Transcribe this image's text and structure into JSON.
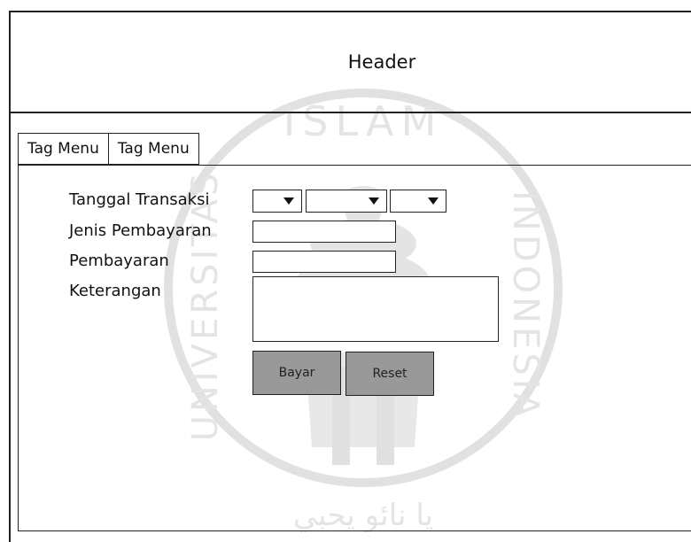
{
  "header": {
    "title": "Header"
  },
  "tabs": [
    {
      "label": "Tag Menu"
    },
    {
      "label": "Tag Menu"
    }
  ],
  "form": {
    "fields": [
      {
        "label": "Tanggal Transaksi"
      },
      {
        "label": "Jenis Pembayaran"
      },
      {
        "label": "Pembayaran"
      },
      {
        "label": "Keterangan"
      }
    ],
    "buttons": [
      {
        "label": "Bayar"
      },
      {
        "label": "Reset"
      }
    ]
  },
  "watermark": {
    "top_text": "ISLAM",
    "left_text": "UNIVERSITAS",
    "right_text": "INDONESIA",
    "bottom_text": "يا نائو يحبي"
  }
}
